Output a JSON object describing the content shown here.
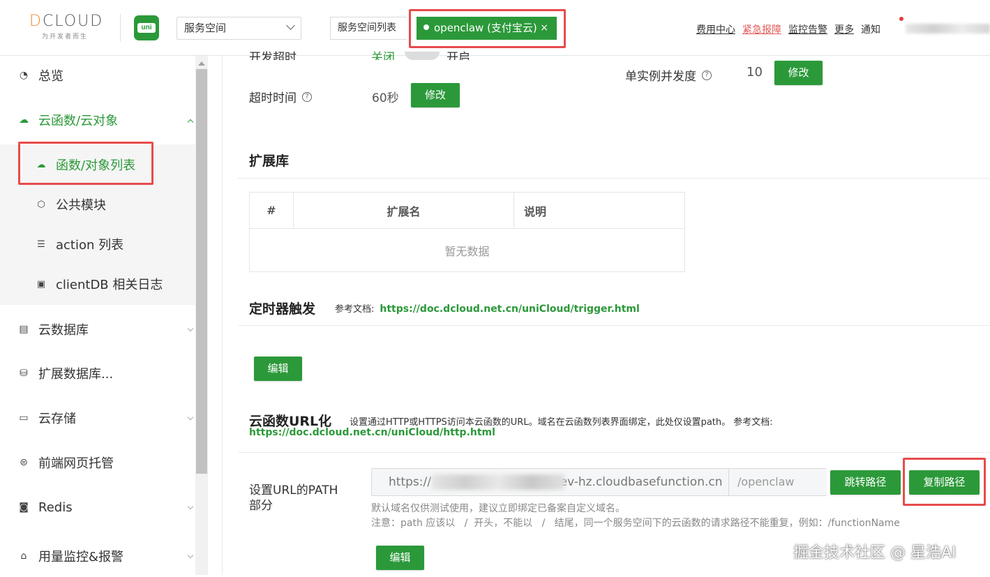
{
  "header": {
    "logo_text": "DCLOUD",
    "logo_tagline": "为开发者而生",
    "app_badge": "uni",
    "space_select_value": "服务空间",
    "space_list_label": "服务空间列表",
    "active_tab_label": "openclaw (支付宝云)",
    "active_tab_close": "×",
    "links": [
      "费用中心",
      "紧急报障",
      "监控告警",
      "更多"
    ],
    "notice_label": "通知"
  },
  "sidebar": {
    "items": [
      {
        "label": "总览",
        "icon": "dashboard-icon"
      },
      {
        "label": "云函数/云对象",
        "icon": "cloud-icon",
        "active": true
      },
      {
        "label": "云数据库",
        "icon": "database-icon"
      },
      {
        "label": "扩展数据库...",
        "icon": "stack-database-icon"
      },
      {
        "label": "云存储",
        "icon": "storage-icon"
      },
      {
        "label": "前端网页托管",
        "icon": "hosting-icon"
      },
      {
        "label": "Redis",
        "icon": "redis-icon"
      },
      {
        "label": "用量监控&报警",
        "icon": "monitor-icon"
      }
    ],
    "sub_items": [
      {
        "label": "函数/对象列表",
        "icon": "cloud-icon",
        "active": true
      },
      {
        "label": "公共模块",
        "icon": "cube-icon"
      },
      {
        "label": "action 列表",
        "icon": "list-icon"
      },
      {
        "label": "clientDB 相关日志",
        "icon": "log-icon"
      }
    ]
  },
  "main": {
    "partial_row": {
      "left_text": "开发超时",
      "status": "关闭",
      "status_right": "开启"
    },
    "concurrency": {
      "label": "单实例并发度",
      "value": "10",
      "button": "修改"
    },
    "timeout": {
      "label": "超时时间",
      "value": "60秒",
      "button": "修改"
    },
    "extensions": {
      "title": "扩展库",
      "columns": [
        "#",
        "扩展名",
        "说明"
      ],
      "empty_text": "暂无数据"
    },
    "timer": {
      "title": "定时器触发",
      "ref_label": "参考文档:",
      "ref_link": "https://doc.dcloud.net.cn/uniCloud/trigger.html",
      "edit_button": "编辑"
    },
    "url": {
      "title": "云函数URL化",
      "description": "设置通过HTTP或HTTPS访问本云函数的URL。域名在云函数列表界面绑定，此处仅设置path。 参考文档:",
      "ref_link": "https://doc.dcloud.net.cn/uniCloud/http.html",
      "path_label_line1": "设置URL的PATH",
      "path_label_line2": "部分",
      "host_prefix": "https://",
      "host_suffix": "lev-hz.cloudbasefunction.cn",
      "path_value": "/openclaw",
      "jump_button": "跳转路径",
      "copy_button": "复制路径",
      "hint1": "默认域名仅供测试使用，建议立即绑定已备案自定义域名。",
      "hint2": "注意：path 应该以   /  开头，不能以   /   结尾，同一个服务空间下的云函数的请求路径不能重复，例如：/functionName",
      "edit_button": "编辑"
    }
  },
  "watermark": "掘金技术社区 @ 星浩AI",
  "colors": {
    "brand_green": "#2b9939",
    "highlight_red": "#e74c4c",
    "urgent_link": "#e35a5a"
  }
}
